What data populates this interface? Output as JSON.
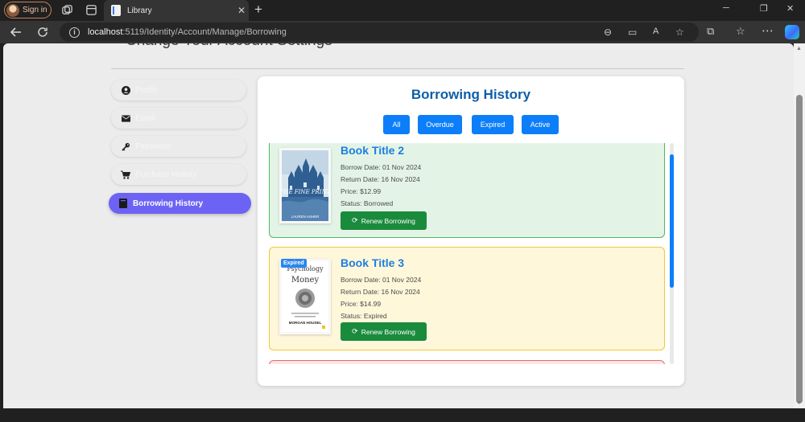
{
  "browser": {
    "signin_label": "Sign in",
    "tab_title": "Library",
    "url_host": "localhost",
    "url_path": ":5119/Identity/Account/Manage/Borrowing"
  },
  "page": {
    "heading": "Change Your Account Settings"
  },
  "sidebar": {
    "items": [
      {
        "label": "Profile",
        "icon": "user-circle-icon"
      },
      {
        "label": "Email",
        "icon": "envelope-icon"
      },
      {
        "label": "Password",
        "icon": "key-icon"
      },
      {
        "label": "Purchase History",
        "icon": "cart-icon"
      },
      {
        "label": "Borrowing History",
        "icon": "book-icon",
        "active": true
      }
    ]
  },
  "main": {
    "title": "Borrowing History",
    "filters": [
      "All",
      "Overdue",
      "Expired",
      "Active"
    ],
    "entries": [
      {
        "title": "Book Title 2",
        "borrow_date": "Borrow Date: 01 Nov 2024",
        "return_date": "Return Date: 16 Nov 2024",
        "price": "Price: $12.99",
        "status": "Status: Borrowed",
        "button": "Renew Borrowing",
        "cover_text": "THE FINE PRINT",
        "cover_author": "LAUREN ASHER"
      },
      {
        "title": "Book Title 3",
        "badge": "Expired",
        "borrow_date": "Borrow Date: 01 Nov 2024",
        "return_date": "Return Date: 16 Nov 2024",
        "price": "Price: $14.99",
        "status": "Status: Expired",
        "button": "Renew Borrowing",
        "cover_text_1": "Psychology",
        "cover_text_2": "Money",
        "cover_author": "MORGAN HOUSEL"
      }
    ]
  },
  "colors": {
    "accent": "#0d7ef9",
    "sidebar_active": "#6c63f5",
    "renew_button": "#1a8b3c",
    "title": "#0e5ea8"
  }
}
